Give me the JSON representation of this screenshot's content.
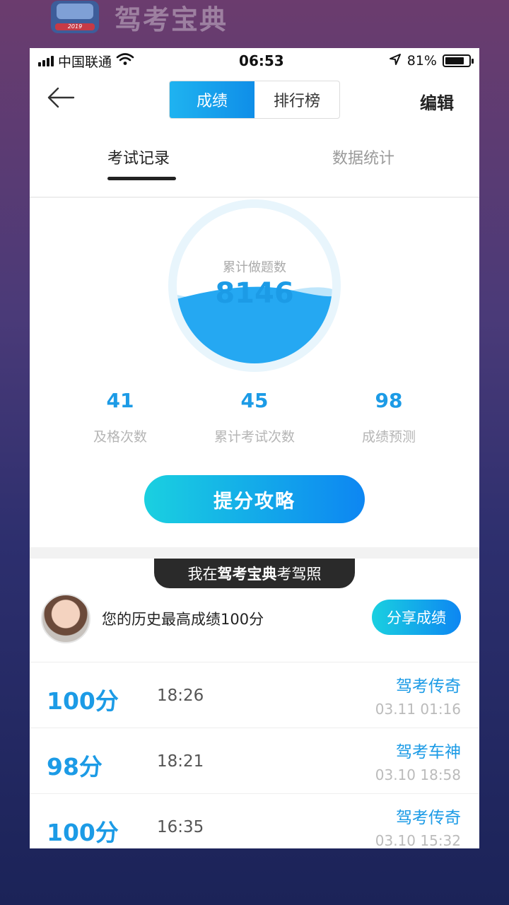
{
  "background": {
    "app_title": "驾考宝典",
    "logo_year": "2019"
  },
  "status_bar": {
    "carrier": "中国联通",
    "time": "06:53",
    "battery": "81%"
  },
  "nav": {
    "segments": [
      "成绩",
      "排行榜"
    ],
    "active_segment": "成绩",
    "edit_label": "编辑"
  },
  "tabs": {
    "items": [
      "考试记录",
      "数据统计"
    ],
    "active": "考试记录"
  },
  "gauge": {
    "label": "累计做题数",
    "value": "8146",
    "fill_fraction": 0.45
  },
  "stats": [
    {
      "value": "41",
      "label": "及格次数"
    },
    {
      "value": "45",
      "label": "累计考试次数"
    },
    {
      "value": "98",
      "label": "成绩预测"
    }
  ],
  "boost_button": "提分攻略",
  "share_pill": {
    "prefix": "我在",
    "brand": "驾考宝典",
    "suffix": "考驾照"
  },
  "best": {
    "text": "您的历史最高成绩100分",
    "share_button": "分享成绩"
  },
  "records": [
    {
      "score": "100分",
      "duration": "18:26",
      "title": "驾考传奇",
      "date": "03.11 01:16"
    },
    {
      "score": "98分",
      "duration": "18:21",
      "title": "驾考车神",
      "date": "03.10 18:58"
    },
    {
      "score": "100分",
      "duration": "16:35",
      "title": "驾考传奇",
      "date": "03.10 15:32"
    }
  ],
  "colors": {
    "accent": "#1c9be6",
    "gradient_start": "#1ad0e0",
    "gradient_end": "#0d86f2"
  }
}
